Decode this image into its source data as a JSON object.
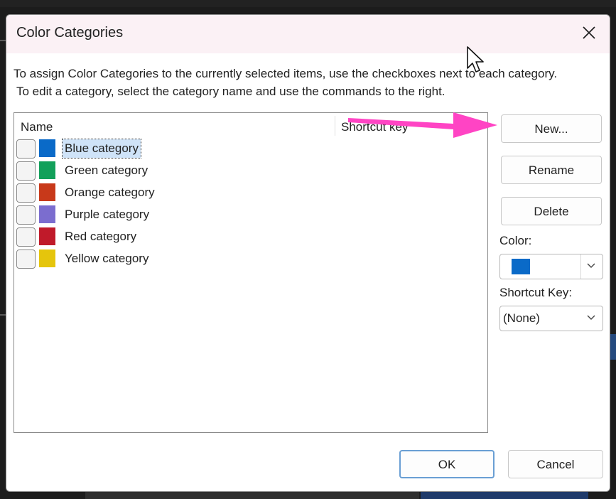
{
  "dialog": {
    "title": "Color Categories",
    "instructions": [
      "To assign Color Categories to the currently selected items, use the checkboxes next to each category.",
      "To edit a category, select the category name and use the commands to the right."
    ]
  },
  "list": {
    "columns": {
      "name": "Name",
      "shortcut": "Shortcut key"
    },
    "items": [
      {
        "label": "Blue category",
        "color": "#0a6ac8",
        "checked": false,
        "selected": true
      },
      {
        "label": "Green category",
        "color": "#12a05a",
        "checked": false,
        "selected": false
      },
      {
        "label": "Orange category",
        "color": "#c8391a",
        "checked": false,
        "selected": false
      },
      {
        "label": "Purple category",
        "color": "#7b6dcf",
        "checked": false,
        "selected": false
      },
      {
        "label": "Red category",
        "color": "#c01a2a",
        "checked": false,
        "selected": false
      },
      {
        "label": "Yellow category",
        "color": "#e5c50c",
        "checked": false,
        "selected": false
      }
    ]
  },
  "buttons": {
    "new": "New...",
    "rename": "Rename",
    "delete": "Delete",
    "ok": "OK",
    "cancel": "Cancel"
  },
  "color_field": {
    "label": "Color:",
    "value_color": "#0a6ac8"
  },
  "shortcut_field": {
    "label": "Shortcut Key:",
    "value": "(None)"
  },
  "annotation": {
    "arrow_color": "#ff44c4"
  }
}
